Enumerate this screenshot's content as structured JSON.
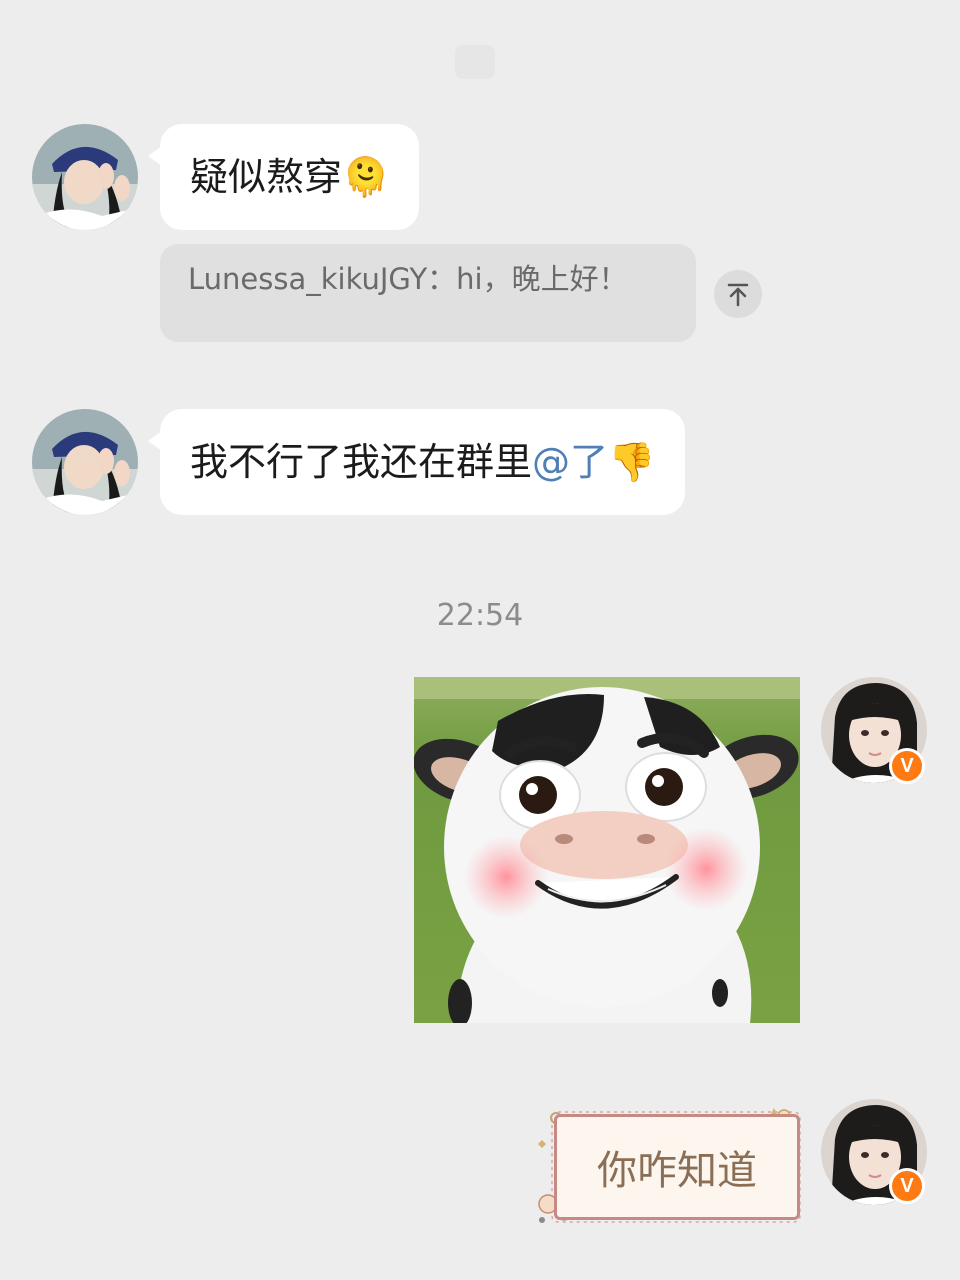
{
  "messages": {
    "m1": {
      "text": "疑似熬穿",
      "emoji": "🫠"
    },
    "quote": {
      "text": "Lunessa_kikuJGY：hi，晚上好！"
    },
    "m2": {
      "text": "我不行了我还在群里",
      "mention": "@了",
      "emoji": "👎"
    },
    "timestamp": "22:54",
    "m4": {
      "text": "你咋知道"
    }
  },
  "icons": {
    "jump_to_quote": "arrow-to-top-icon",
    "verified_badge": "v-badge-icon",
    "verified_letter": "V"
  },
  "colors": {
    "background": "#ededed",
    "mention": "#4f7fb5",
    "badge": "#ff7a12"
  }
}
